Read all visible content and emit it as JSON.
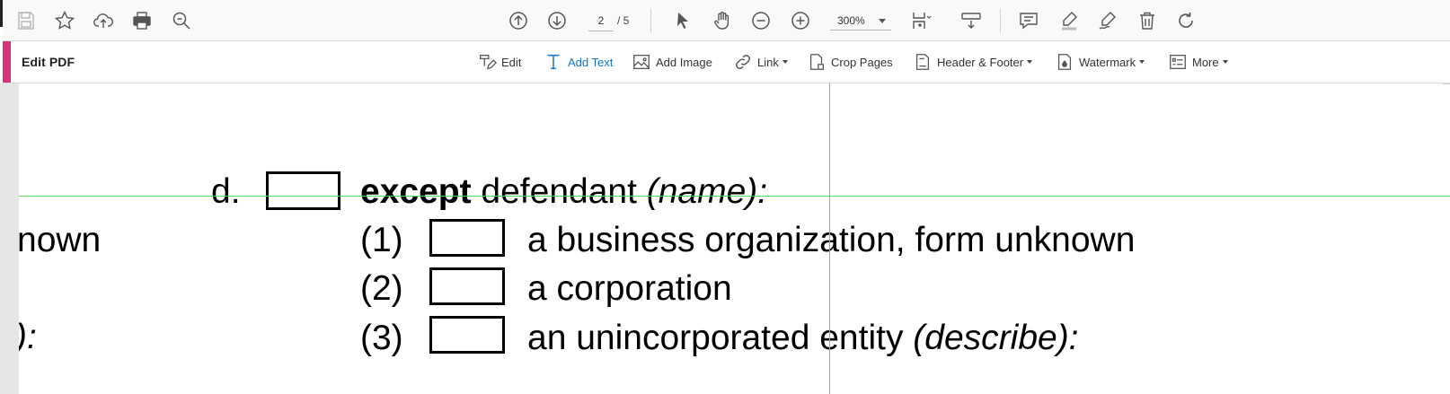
{
  "top_toolbar": {
    "save_icon": "save-icon",
    "star_icon": "star-icon",
    "upload_icon": "cloud-upload-icon",
    "print_icon": "print-icon",
    "zoom_search_icon": "search-zoom-icon",
    "prev_page_icon": "arrow-up-circle-icon",
    "next_page_icon": "arrow-down-circle-icon",
    "current_page": "2",
    "page_total": "/ 5",
    "zoom_out_icon": "minus-circle-icon",
    "zoom_in_icon": "plus-circle-icon",
    "zoom_level": "300%",
    "right_tools": [
      "page-fit-icon",
      "scroll-mode-icon",
      "comment-icon",
      "highlight-icon",
      "sign-icon",
      "delete-icon",
      "rotate-icon"
    ]
  },
  "edit_toolbar": {
    "title": "Edit PDF",
    "accent_color": "#d6347a",
    "active_color": "#1473c6",
    "tools": {
      "edit": "Edit",
      "add_text": "Add Text",
      "add_image": "Add Image",
      "link": "Link",
      "crop_pages": "Crop Pages",
      "header_footer": "Header & Footer",
      "watermark": "Watermark",
      "more": "More"
    }
  },
  "document": {
    "guide_color": "#58d858",
    "line_d": {
      "letter": "d.",
      "bold_word": "except",
      "rest": " defendant ",
      "italic": "(name):"
    },
    "left_fragments": [
      "nown",
      "):"
    ],
    "options": [
      {
        "num": "(1)",
        "text": "a business organization, form unknown",
        "italic": ""
      },
      {
        "num": "(2)",
        "text": "a corporation",
        "italic": ""
      },
      {
        "num": "(3)",
        "text": "an unincorporated entity ",
        "italic": "(describe):"
      }
    ]
  }
}
